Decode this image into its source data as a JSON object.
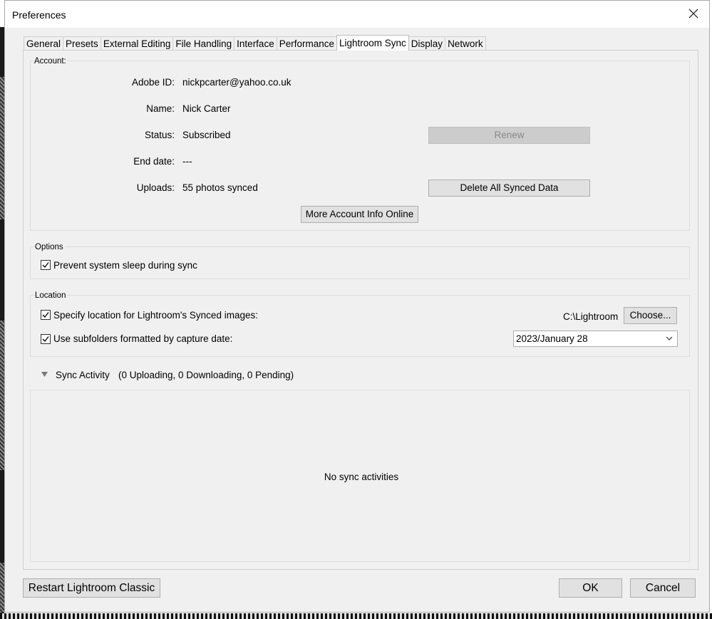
{
  "window": {
    "title": "Preferences",
    "close_icon": "close-icon"
  },
  "tabs": [
    {
      "label": "General"
    },
    {
      "label": "Presets"
    },
    {
      "label": "External Editing"
    },
    {
      "label": "File Handling"
    },
    {
      "label": "Interface"
    },
    {
      "label": "Performance"
    },
    {
      "label": "Lightroom Sync",
      "active": true
    },
    {
      "label": "Display"
    },
    {
      "label": "Network"
    }
  ],
  "account": {
    "group_label": "Account:",
    "adobe_id_label": "Adobe ID:",
    "adobe_id_value": "nickpcarter@yahoo.co.uk",
    "name_label": "Name:",
    "name_value": "Nick Carter",
    "status_label": "Status:",
    "status_value": "Subscribed",
    "end_date_label": "End date:",
    "end_date_value": "---",
    "uploads_label": "Uploads:",
    "uploads_value": "55 photos synced",
    "renew_button": "Renew",
    "delete_button": "Delete All Synced Data",
    "more_info_button": "More Account Info Online"
  },
  "options": {
    "group_label": "Options",
    "prevent_sleep_label": "Prevent system sleep during sync",
    "prevent_sleep_checked": true
  },
  "location": {
    "group_label": "Location",
    "specify_label": "Specify location for Lightroom's Synced images:",
    "specify_checked": true,
    "path_value": "C:\\Lightroom",
    "choose_button": "Choose...",
    "subfolders_label": "Use subfolders formatted by capture date:",
    "subfolders_checked": true,
    "date_format_selected": "2023/January 28"
  },
  "sync_activity": {
    "label": "Sync Activity",
    "summary": "(0 Uploading, 0 Downloading, 0 Pending)",
    "empty_message": "No sync activities"
  },
  "footer": {
    "restart_button": "Restart Lightroom Classic",
    "ok_button": "OK",
    "cancel_button": "Cancel"
  }
}
